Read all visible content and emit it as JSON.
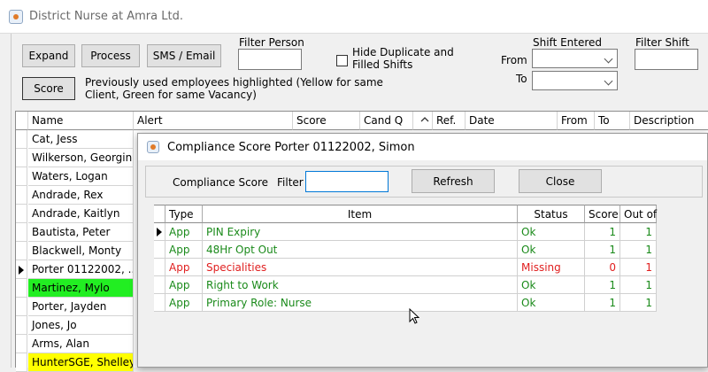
{
  "window": {
    "title": "District Nurse at Amra Ltd."
  },
  "toolbar": {
    "expand": "Expand",
    "process": "Process",
    "sms_email": "SMS / Email",
    "score": "Score",
    "filter_person_label": "Filter Person",
    "hide_duplicate_label": "Hide Duplicate and\nFilled Shifts",
    "highlight_note": "Previously used employees highlighted (Yellow for same\nClient, Green for same Vacancy)",
    "shift_entered_label": "Shift Entered",
    "from_label": "From",
    "to_label": "To",
    "filter_shift_label": "Filter Shift"
  },
  "grid": {
    "headers": [
      "Name",
      "Alert",
      "Score",
      "Cand Q",
      "Ref.",
      "Date",
      "From",
      "To",
      "Description"
    ],
    "rows": [
      {
        "name": "Cat, Jess"
      },
      {
        "name": "Wilkerson, Georgina"
      },
      {
        "name": "Waters, Logan"
      },
      {
        "name": "Andrade, Rex"
      },
      {
        "name": "Andrade, Kaitlyn"
      },
      {
        "name": "Bautista, Peter"
      },
      {
        "name": "Blackwell, Monty"
      },
      {
        "name": "Porter 01122002, ...",
        "selected": true
      },
      {
        "name": "Martinez, Mylo",
        "highlight": "#22ee22"
      },
      {
        "name": "Porter, Jayden"
      },
      {
        "name": "Jones, Jo"
      },
      {
        "name": "Arms, Alan"
      },
      {
        "name": "HunterSGE, Shelley",
        "highlight": "#ffff00"
      }
    ]
  },
  "dialog": {
    "title": "Compliance Score  Porter 01122002, Simon",
    "compliance_score_label": "Compliance Score",
    "filter_label": "Filter",
    "filter_value": "",
    "refresh": "Refresh",
    "close": "Close",
    "columns": [
      "Type",
      "Item",
      "Status",
      "Score",
      "Out of"
    ],
    "rows": [
      {
        "type": "App",
        "item": "PIN Expiry",
        "status": "Ok",
        "score": "1",
        "out_of": "1",
        "color": "green",
        "current": true
      },
      {
        "type": "App",
        "item": "48Hr Opt Out",
        "status": "Ok",
        "score": "1",
        "out_of": "1",
        "color": "green"
      },
      {
        "type": "App",
        "item": "Specialities",
        "status": "Missing",
        "score": "0",
        "out_of": "1",
        "color": "red"
      },
      {
        "type": "App",
        "item": "Right to Work",
        "status": "Ok",
        "score": "1",
        "out_of": "1",
        "color": "green"
      },
      {
        "type": "App",
        "item": "Primary Role: Nurse",
        "status": "Ok",
        "score": "1",
        "out_of": "1",
        "color": "green"
      }
    ]
  },
  "colors": {
    "ok": "#1a8a1a",
    "missing": "#e02020",
    "same_vacancy": "#22ee22",
    "same_client": "#ffff00"
  },
  "icons": [
    "app-icon",
    "dropdown-arrow-icon",
    "sort-arrow-icon",
    "row-pointer-icon",
    "mouse-cursor-icon"
  ]
}
